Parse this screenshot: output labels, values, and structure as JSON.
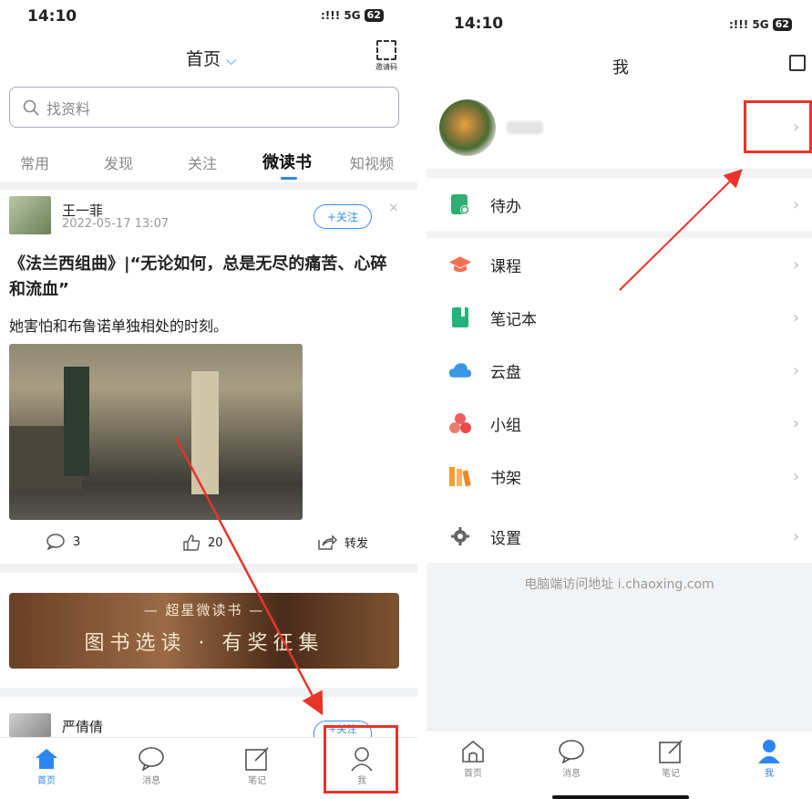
{
  "left": {
    "status": {
      "time": "14:10",
      "signal": ":!!! 5G",
      "battery": "62"
    },
    "header": {
      "title": "首页",
      "invite_label": "邀请码"
    },
    "search": {
      "placeholder": "找资料"
    },
    "tabs": [
      {
        "label": "常用"
      },
      {
        "label": "发现"
      },
      {
        "label": "关注"
      },
      {
        "label": "微读书",
        "active": true
      },
      {
        "label": "知视频"
      }
    ],
    "post": {
      "author": "王一菲",
      "date": "2022-05-17 13:07",
      "follow_label": "+关注",
      "close": "×",
      "title": "《法兰西组曲》|“无论如何，总是无尽的痛苦、心碎和流血”",
      "excerpt": "她害怕和布鲁诺单独相处的时刻。",
      "comments": "3",
      "likes": "20",
      "share_label": "转发"
    },
    "banner": {
      "line1": "— 超星微读书 —",
      "line2": "图书选读 · 有奖征集"
    },
    "post2": {
      "author": "严倩倩",
      "follow_label": "+关注"
    },
    "tabbar": [
      {
        "label": "首页",
        "icon": "home-icon",
        "active": true
      },
      {
        "label": "消息",
        "icon": "message-icon"
      },
      {
        "label": "笔记",
        "icon": "note-icon"
      },
      {
        "label": "我",
        "icon": "person-icon"
      }
    ]
  },
  "right": {
    "status": {
      "time": "14:10",
      "signal": ":!!! 5G",
      "battery": "62"
    },
    "header": {
      "title": "我"
    },
    "menu": [
      {
        "label": "待办",
        "icon": "todo-icon",
        "color": "#2fae73"
      },
      {
        "label": "课程",
        "icon": "course-icon",
        "color": "#f07151"
      },
      {
        "label": "笔记本",
        "icon": "notebook-icon",
        "color": "#25b47e"
      },
      {
        "label": "云盘",
        "icon": "cloud-icon",
        "color": "#3a96e8"
      },
      {
        "label": "小组",
        "icon": "group-icon",
        "color": "#f05d5d"
      },
      {
        "label": "书架",
        "icon": "bookshelf-icon",
        "color": "#f49c32"
      }
    ],
    "settings": {
      "label": "设置",
      "icon": "gear-icon"
    },
    "footer": "电脑端访问地址 i.chaoxing.com",
    "tabbar": [
      {
        "label": "首页",
        "icon": "home-icon"
      },
      {
        "label": "消息",
        "icon": "message-icon"
      },
      {
        "label": "笔记",
        "icon": "note-icon"
      },
      {
        "label": "我",
        "icon": "person-icon",
        "active": true
      }
    ]
  },
  "colors": {
    "accent": "#2a86f0",
    "highlight": "#e8342a"
  }
}
